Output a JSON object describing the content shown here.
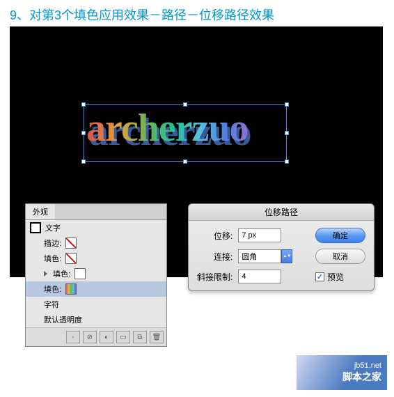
{
  "instruction": "9、对第3个填色应用效果－路径－位移路径效果",
  "artwork_text": "archerzuo",
  "appearance": {
    "tab": "外观",
    "rows": {
      "text": "文字",
      "stroke": "描边:",
      "fill": "填色:",
      "character": "字符",
      "default_transparency": "默认透明度"
    }
  },
  "dialog": {
    "title": "位移路径",
    "offset_label": "位移:",
    "offset_value": "7 px",
    "join_label": "连接:",
    "join_value": "圆角",
    "miter_label": "斜接限制:",
    "miter_value": "4",
    "ok": "确定",
    "cancel": "取消",
    "preview": "预览"
  },
  "watermark": {
    "url": "jb51.net",
    "name": "脚本之家"
  }
}
